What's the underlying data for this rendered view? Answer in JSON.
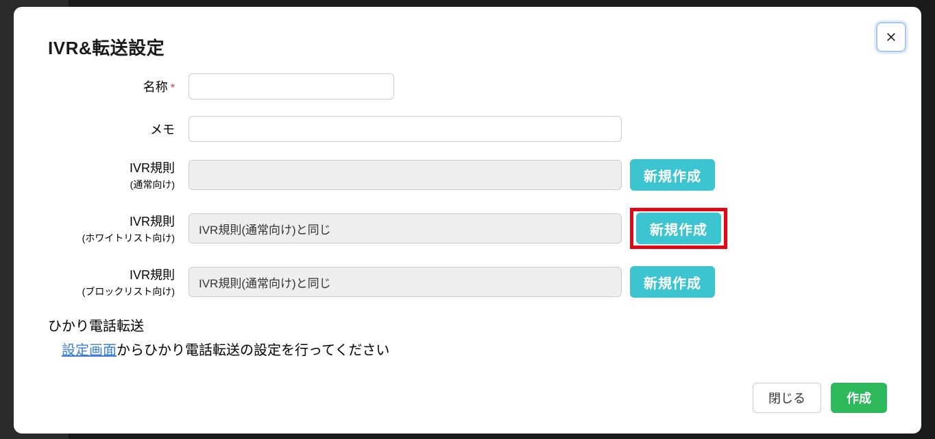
{
  "modal": {
    "title": "IVR&転送設定",
    "close_aria": "close"
  },
  "form": {
    "name": {
      "label": "名称",
      "required_mark": "*",
      "value": ""
    },
    "memo": {
      "label": "メモ",
      "value": ""
    },
    "ivr_normal": {
      "label": "IVR規則",
      "sub_label": "(通常向け)",
      "selected": "",
      "create_btn": "新規作成"
    },
    "ivr_whitelist": {
      "label": "IVR規則",
      "sub_label": "(ホワイトリスト向け)",
      "selected": "IVR規則(通常向け)と同じ",
      "create_btn": "新規作成"
    },
    "ivr_blocklist": {
      "label": "IVR規則",
      "sub_label": "(ブロックリスト向け)",
      "selected": "IVR規則(通常向け)と同じ",
      "create_btn": "新規作成"
    }
  },
  "hikari": {
    "title": "ひかり電話転送",
    "link_text": "設定画面",
    "desc_rest": "からひかり電話転送の設定を行ってください"
  },
  "footer": {
    "close": "閉じる",
    "create": "作成"
  }
}
